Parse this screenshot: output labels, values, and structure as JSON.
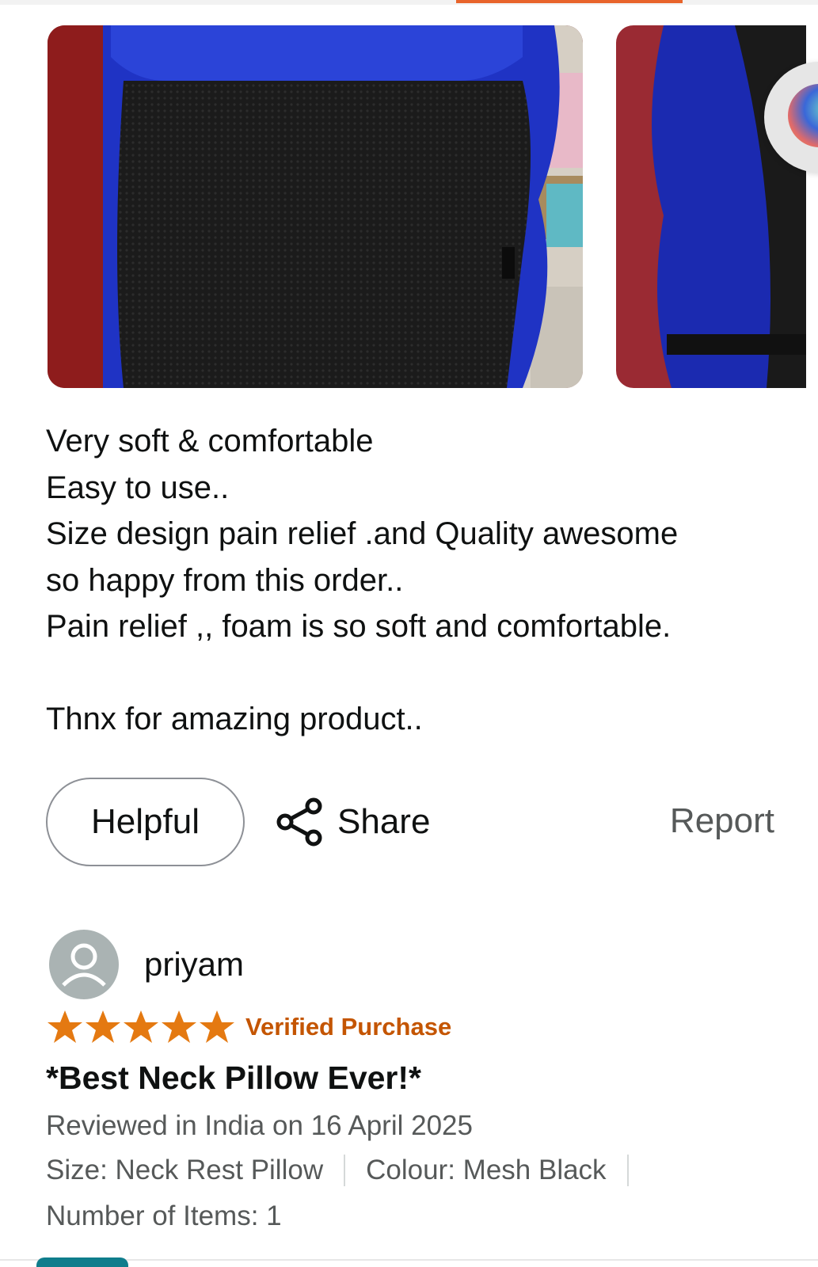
{
  "review_body": {
    "lines": [
      "Very soft & comfortable",
      "Easy to use..",
      "Size design pain relief .and Quality awesome",
      "so happy from this order..",
      "Pain relief ,, foam is so soft and comfortable.",
      "",
      "Thnx for amazing product.."
    ]
  },
  "actions": {
    "helpful_label": "Helpful",
    "share_label": "Share",
    "report_label": "Report"
  },
  "next_review": {
    "reviewer_name": "priyam",
    "rating": 5,
    "rating_max": 5,
    "verified_label": "Verified Purchase",
    "title": "*Best Neck Pillow Ever!*",
    "date_text": "Reviewed in India on 16 April 2025",
    "size_text": "Size: Neck Rest Pillow",
    "colour_text": "Colour: Mesh Black",
    "items_text": "Number of Items: 1"
  },
  "colors": {
    "accent_orange": "#e8642b",
    "star_orange": "#e47911",
    "verified_orange": "#c45500",
    "muted_text": "#565959"
  },
  "icons": [
    "share-icon",
    "avatar-user-icon",
    "star-icon"
  ]
}
